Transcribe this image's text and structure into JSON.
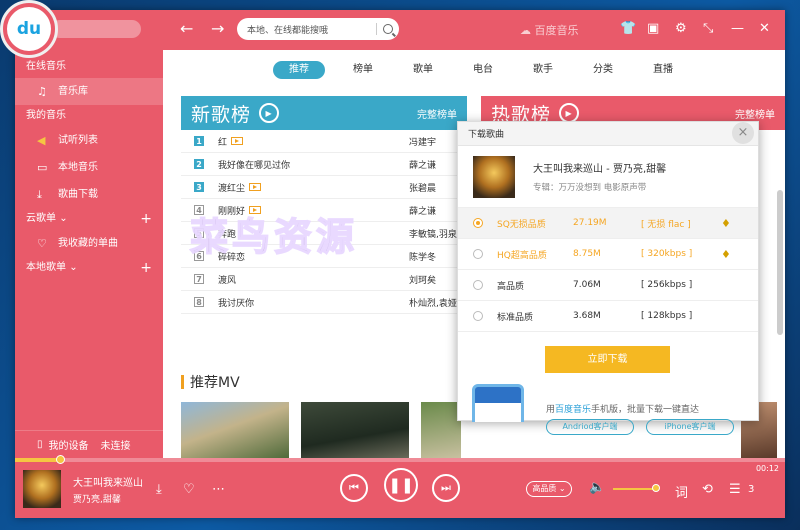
{
  "app": {
    "logo_text": "du",
    "brand": "百度音乐"
  },
  "search": {
    "placeholder": "本地、在线都能搜哦"
  },
  "sidebar": {
    "online_header": "在线音乐",
    "music_lib": "音乐库",
    "my_music_header": "我的音乐",
    "trial_list": "试听列表",
    "local_music": "本地音乐",
    "downloads": "歌曲下载",
    "cloud_header": "云歌单",
    "favorites": "我收藏的单曲",
    "local_playlist_header": "本地歌单",
    "device": "我的设备",
    "device_status": "未连接"
  },
  "tabs": [
    "推荐",
    "榜单",
    "歌单",
    "电台",
    "歌手",
    "分类",
    "直播"
  ],
  "new_chart": {
    "title": "新歌榜",
    "more": "完整榜单",
    "color": "#3aa8c8",
    "songs": [
      {
        "rank": "1",
        "title": "红",
        "mv": true,
        "artist": "冯建宇"
      },
      {
        "rank": "2",
        "title": "我好像在哪见过你",
        "mv": false,
        "artist": "薛之谦"
      },
      {
        "rank": "3",
        "title": "渡红尘",
        "mv": true,
        "artist": "张碧晨"
      },
      {
        "rank": "4",
        "title": "刚刚好",
        "mv": true,
        "artist": "薛之谦"
      },
      {
        "rank": "5",
        "title": "奔跑",
        "mv": false,
        "artist": "李敏镐,羽泉"
      },
      {
        "rank": "6",
        "title": "碎碎恋",
        "mv": false,
        "artist": "陈学冬"
      },
      {
        "rank": "7",
        "title": "渡风",
        "mv": false,
        "artist": "刘珂矣"
      },
      {
        "rank": "8",
        "title": "我讨厌你",
        "mv": false,
        "artist": "朴灿烈,袁娅"
      }
    ]
  },
  "hot_chart": {
    "title": "热歌榜",
    "more": "完整榜单",
    "color": "#e95a6a"
  },
  "mv_section": {
    "title": "推荐MV"
  },
  "download_dialog": {
    "title": "下载歌曲",
    "close": "×",
    "song": "大王叫我来巡山 - 贾乃亮,甜馨",
    "album": "专辑：万万没想到 电影原声带",
    "options": [
      {
        "quality": "SQ无损品质",
        "size": "27.19M",
        "format": "[ 无损 flac ]",
        "selected": true,
        "vip": true
      },
      {
        "quality": "HQ超高品质",
        "size": "8.75M",
        "format": "[ 320kbps ]",
        "selected": false,
        "vip": true
      },
      {
        "quality": "高品质",
        "size": "7.06M",
        "format": "[ 256kbps ]",
        "selected": false,
        "vip": false
      },
      {
        "quality": "标准品质",
        "size": "3.68M",
        "format": "[ 128kbps ]",
        "selected": false,
        "vip": false
      }
    ],
    "download_button": "立即下载",
    "promo_prefix": "用",
    "promo_brand": "百度音乐",
    "promo_suffix": "手机版，批量下载一键直达",
    "android_button": "Andriod客户端",
    "iphone_button": "iPhone客户端"
  },
  "watermark": "菜鸟资源",
  "player": {
    "song_title": "大王叫我来巡山",
    "artist": "贾乃亮,甜馨",
    "quality": "高品质",
    "time": "00:12",
    "queue_count": "3",
    "lyrics_label": "词"
  }
}
